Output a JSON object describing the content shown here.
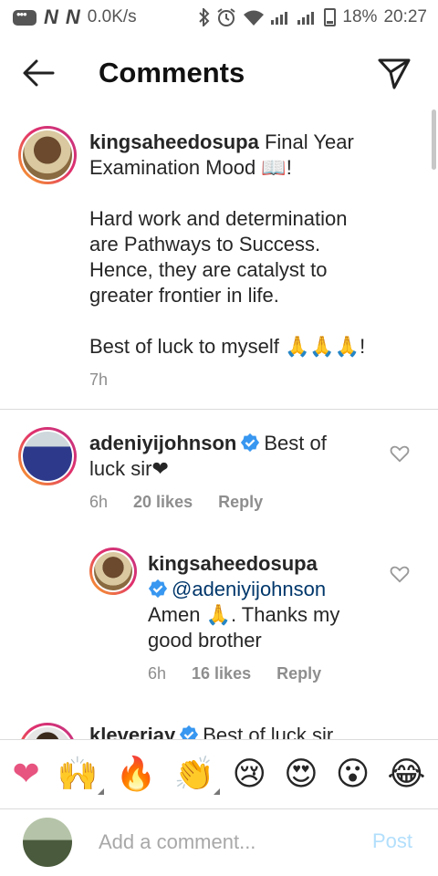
{
  "status_bar": {
    "network_speed": "0.0K/s",
    "n1": "N",
    "n2": "N",
    "battery": "18%",
    "time": "20:27"
  },
  "header": {
    "title": "Comments",
    "back_icon": "arrow-left-icon",
    "send_icon": "paper-plane-icon"
  },
  "caption": {
    "username": "kingsaheedosupa",
    "line1": "Final Year",
    "line2": "Examination Mood 📖!",
    "para1": [
      "Hard work and determination",
      "are Pathways to Success.",
      "Hence, they are catalyst to",
      "greater frontier in life."
    ],
    "para2": "Best of luck to myself 🙏🙏🙏!",
    "time": "7h"
  },
  "comments": [
    {
      "username": "adeniyijohnson",
      "verified": true,
      "text_inline": "Best of",
      "text_line2": "luck sir❤",
      "time": "6h",
      "likes": "20 likes",
      "reply": "Reply"
    },
    {
      "username": "kingsaheedosupa",
      "verified": true,
      "mention": "@adeniyijohnson",
      "line2": "Amen 🙏. Thanks my",
      "line3": "good brother",
      "time": "6h",
      "likes": "16 likes",
      "reply": "Reply"
    },
    {
      "username": "kleveriay",
      "verified": true,
      "text_inline": "Best of luck sir"
    }
  ],
  "emoji_bar": [
    "❤",
    "🙌",
    "🔥",
    "👏",
    "😢",
    "😍",
    "😮",
    "😂"
  ],
  "input": {
    "placeholder": "Add a comment...",
    "post_label": "Post"
  },
  "colors": {
    "link": "#00376b",
    "post_disabled": "#b2dffc",
    "verified": "#3897f0",
    "heart": "#e75480"
  }
}
